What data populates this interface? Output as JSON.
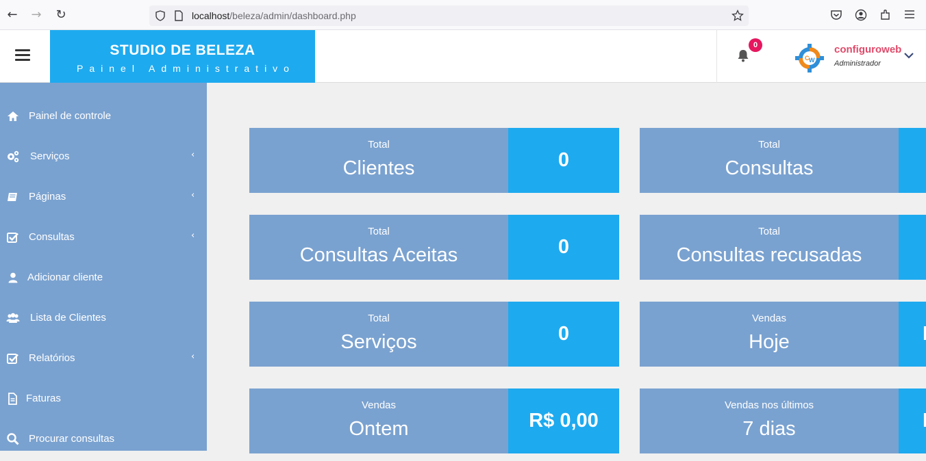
{
  "browser": {
    "url_host": "localhost",
    "url_path": "/beleza/admin/dashboard.php"
  },
  "header": {
    "brand_title": "STUDIO DE BELEZA",
    "brand_subtitle": "Painel Administrativo",
    "notification_count": "0",
    "user_name": "configuroweb",
    "user_role": "Administrador",
    "avatar_letters": "CW"
  },
  "sidebar": {
    "items": [
      {
        "label": "Painel de controle",
        "icon": "home-icon",
        "has_arrow": false
      },
      {
        "label": "Serviços",
        "icon": "cogs-icon",
        "has_arrow": true
      },
      {
        "label": "Páginas",
        "icon": "book-icon",
        "has_arrow": true
      },
      {
        "label": "Consultas",
        "icon": "check-square-icon",
        "has_arrow": true
      },
      {
        "label": "Adicionar cliente",
        "icon": "user-icon",
        "has_arrow": false
      },
      {
        "label": "Lista de Clientes",
        "icon": "users-icon",
        "has_arrow": false
      },
      {
        "label": "Relatórios",
        "icon": "check-square-icon",
        "has_arrow": true
      },
      {
        "label": "Faturas",
        "icon": "file-icon",
        "has_arrow": false
      },
      {
        "label": "Procurar consultas",
        "icon": "search-icon",
        "has_arrow": false
      }
    ],
    "arrow": "‹"
  },
  "cards": {
    "left": [
      {
        "small": "Total",
        "big": "Clientes",
        "value": "0"
      },
      {
        "small": "Total",
        "big": "Consultas Aceitas",
        "value": "0"
      },
      {
        "small": "Total",
        "big": "Serviços",
        "value": "0"
      },
      {
        "small": "Vendas",
        "big": "Ontem",
        "value": "R$ 0,00"
      }
    ],
    "right": [
      {
        "small": "Total",
        "big": "Consultas",
        "value": ""
      },
      {
        "small": "Total",
        "big": "Consultas recusadas",
        "value": ""
      },
      {
        "small": "Vendas",
        "big": "Hoje",
        "value": "R"
      },
      {
        "small": "Vendas nos últimos",
        "big": "7 dias",
        "value": "R"
      }
    ]
  },
  "colors": {
    "brand_blue": "#1eaaef",
    "sidebar_blue": "#7aa2d0",
    "badge_pink": "#e5175f",
    "username_red": "#e04a6a"
  }
}
